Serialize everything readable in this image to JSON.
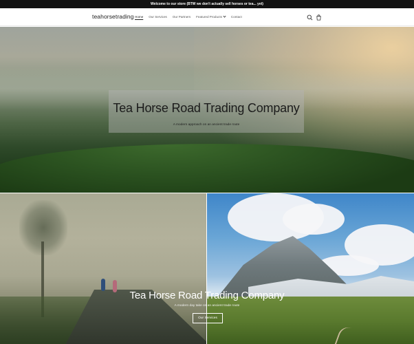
{
  "announcement": {
    "text": "Welcome to our store (BTW we don't actually sell horses or tea... yet)"
  },
  "header": {
    "logo": "teahorsetrading",
    "nav": [
      {
        "label": "Home",
        "active": true
      },
      {
        "label": "Our Services",
        "active": false
      },
      {
        "label": "Our Partners",
        "active": false
      },
      {
        "label": "Featured Products",
        "active": false,
        "dropdown": true
      },
      {
        "label": "Contact",
        "active": false
      }
    ],
    "icons": [
      "search-icon",
      "cart-icon"
    ]
  },
  "hero": {
    "title": "Tea Horse Road Trading Company",
    "subtitle": "A modern approach on an ancient trade route"
  },
  "collage": {
    "title": "Tea Horse Road Trading Company",
    "subtitle": "A modern day take on an ancient trade route",
    "button_label": "Our Services"
  },
  "colors": {
    "announcement_bg": "#121212",
    "header_bg": "#ffffff",
    "text_dark": "#1b1b1b"
  }
}
